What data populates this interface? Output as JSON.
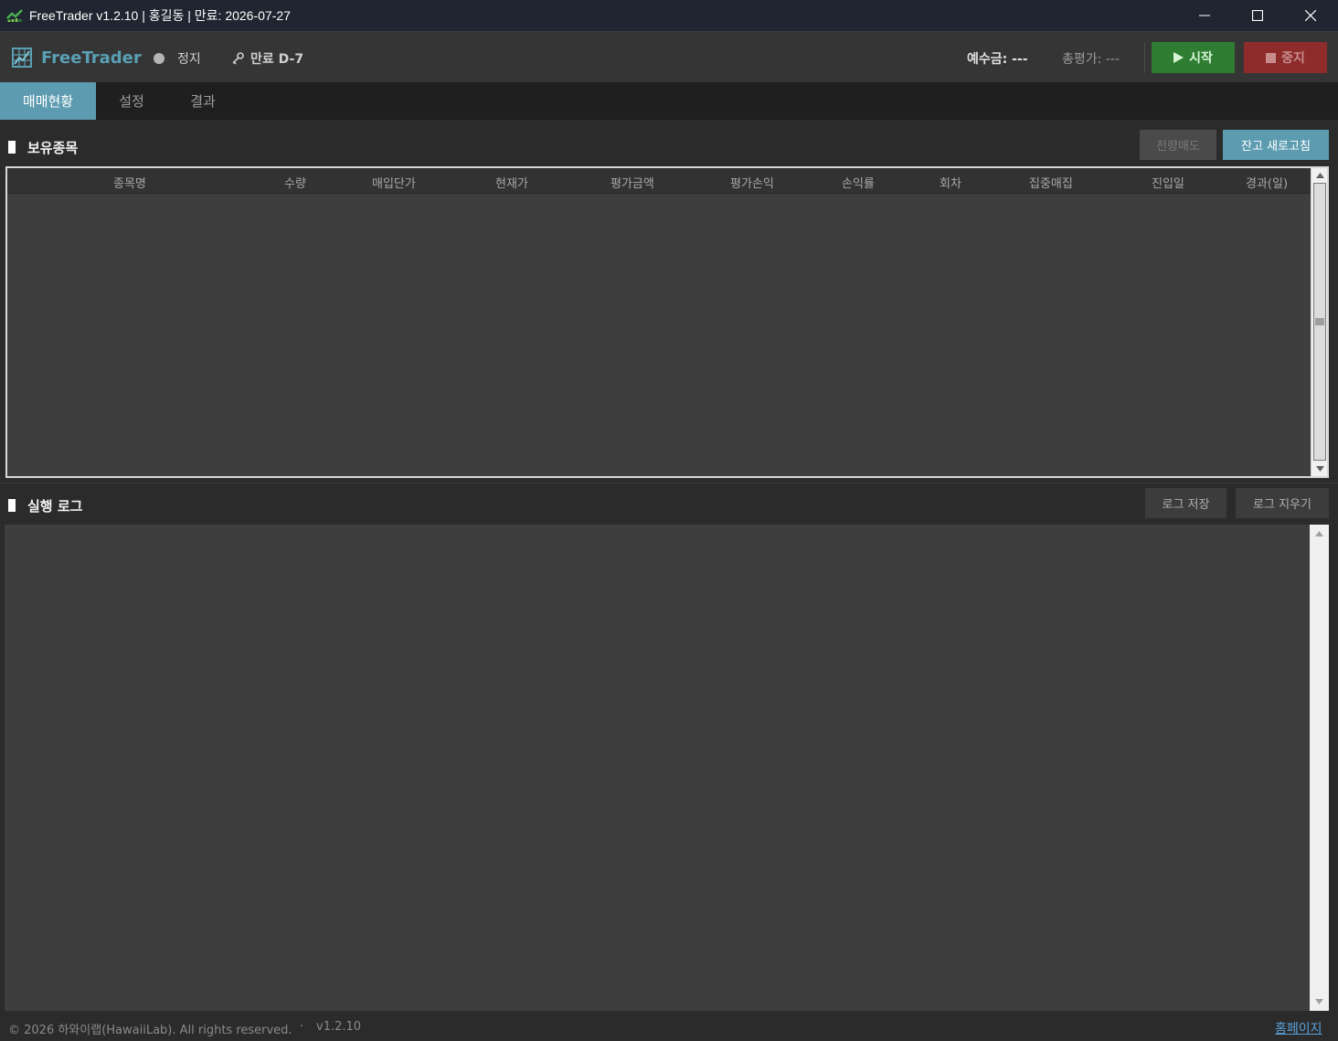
{
  "window": {
    "title": "FreeTrader v1.2.10  |  홍길동  |  만료: 2026-07-27"
  },
  "toolbar": {
    "brand": "FreeTrader",
    "status": "정지",
    "license": "만료 D-7",
    "deposit": "예수금: ---",
    "valuation": "총평가: ---",
    "start_label": "시작",
    "stop_label": "중지",
    "colors": {
      "brand": "#5aa0b5",
      "start": "#2e7d32",
      "stop": "#8e2b2b"
    }
  },
  "tabs": [
    {
      "label": "매매현황",
      "active": true
    },
    {
      "label": "설정",
      "active": false
    },
    {
      "label": "결과",
      "active": false
    }
  ],
  "holdings": {
    "title": "보유종목",
    "sell_all_label": "전량매도",
    "refresh_label": "잔고 새로고침",
    "columns": [
      "종목명",
      "수량",
      "매입단가",
      "현재가",
      "평가금액",
      "평가손익",
      "손익률",
      "회차",
      "집중매집",
      "진입일",
      "경과(일)"
    ],
    "rows": []
  },
  "log": {
    "title": "실행 로그",
    "save_label": "로그 저장",
    "clear_label": "로그 지우기",
    "entries": []
  },
  "footer": {
    "copyright": "© 2026 하와이랩(HawaiiLab). All rights reserved.",
    "separator": "·",
    "version": "v1.2.10",
    "homepage": "홈페이지"
  }
}
